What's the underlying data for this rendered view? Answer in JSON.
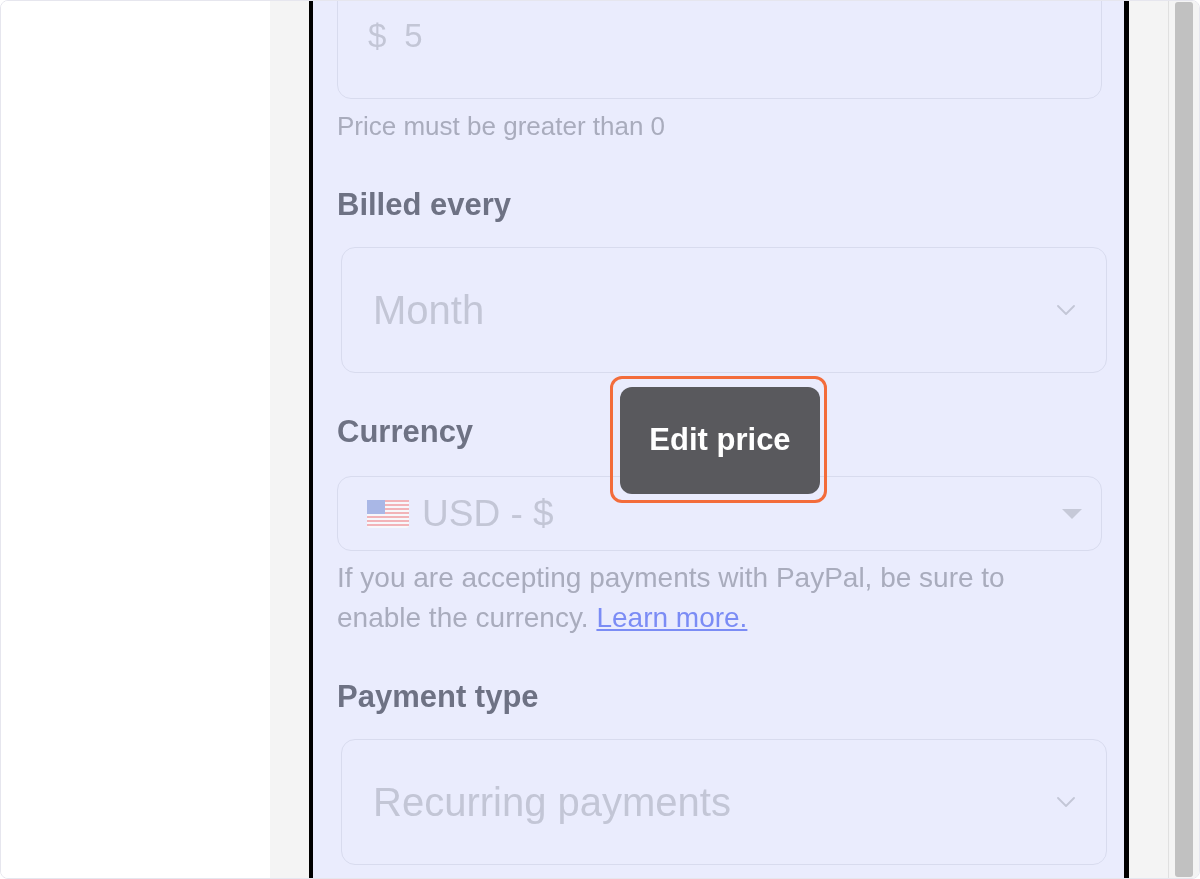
{
  "price_field": {
    "prefix": "$",
    "value": "5",
    "hint": "Price must be greater than 0"
  },
  "fields": [
    {
      "kind": "dropdown",
      "label": "Billed every",
      "value": "Month"
    },
    {
      "kind": "currency",
      "label": "Currency",
      "value": "USD - $",
      "help": "If you are accepting payments with PayPal, be sure to enable the currency.",
      "help_link": "Learn more."
    },
    {
      "kind": "dropdown",
      "label": "Payment type",
      "value": "Recurring payments"
    }
  ],
  "tooltip": {
    "text": "Edit price"
  }
}
